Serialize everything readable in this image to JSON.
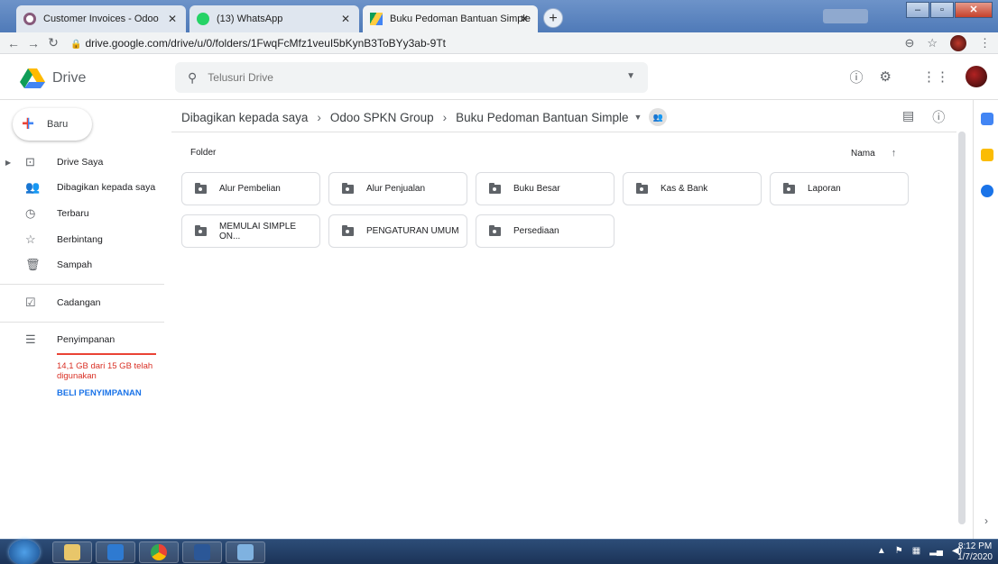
{
  "browser": {
    "tabs": [
      {
        "title": "Customer Invoices - Odoo",
        "active": false,
        "icon": "odoo-icon"
      },
      {
        "title": "(13) WhatsApp",
        "active": false,
        "icon": "whatsapp-icon"
      },
      {
        "title": "Buku Pedoman Bantuan Simple",
        "active": true,
        "icon": "drive-icon"
      }
    ],
    "url": "drive.google.com/drive/u/0/folders/1FwqFcMfz1veuI5bKynB3ToBYy3ab-9Tt"
  },
  "drive": {
    "brand": "Drive",
    "search_placeholder": "Telusuri Drive"
  },
  "sidebar": {
    "new_label": "Baru",
    "items": [
      {
        "label": "Drive Saya",
        "icon": "my-drive-icon"
      },
      {
        "label": "Dibagikan kepada saya",
        "icon": "shared-with-me-icon"
      },
      {
        "label": "Terbaru",
        "icon": "recent-clock-icon"
      },
      {
        "label": "Berbintang",
        "icon": "star-icon"
      },
      {
        "label": "Sampah",
        "icon": "trash-icon"
      },
      {
        "label": "Cadangan",
        "icon": "backup-icon"
      },
      {
        "label": "Penyimpanan",
        "icon": "storage-icon"
      }
    ],
    "storage_text": "14,1 GB dari 15 GB telah digunakan",
    "buy_storage": "BELI PENYIMPANAN"
  },
  "breadcrumb": [
    "Dibagikan kepada saya",
    "Odoo SPKN Group",
    "Buku Pedoman Bantuan Simple"
  ],
  "main": {
    "section_label": "Folder",
    "sort_label": "Nama",
    "folders": [
      "Alur Pembelian",
      "Alur Penjualan",
      "Buku Besar",
      "Kas & Bank",
      "Laporan",
      "MEMULAI SIMPLE ON...",
      "PENGATURAN UMUM",
      "Persediaan"
    ]
  },
  "taskbar": {
    "time": "8:12 PM",
    "date": "1/7/2020"
  },
  "colors": {
    "accent": "#1a73e8",
    "storage_warning": "#d93025"
  }
}
